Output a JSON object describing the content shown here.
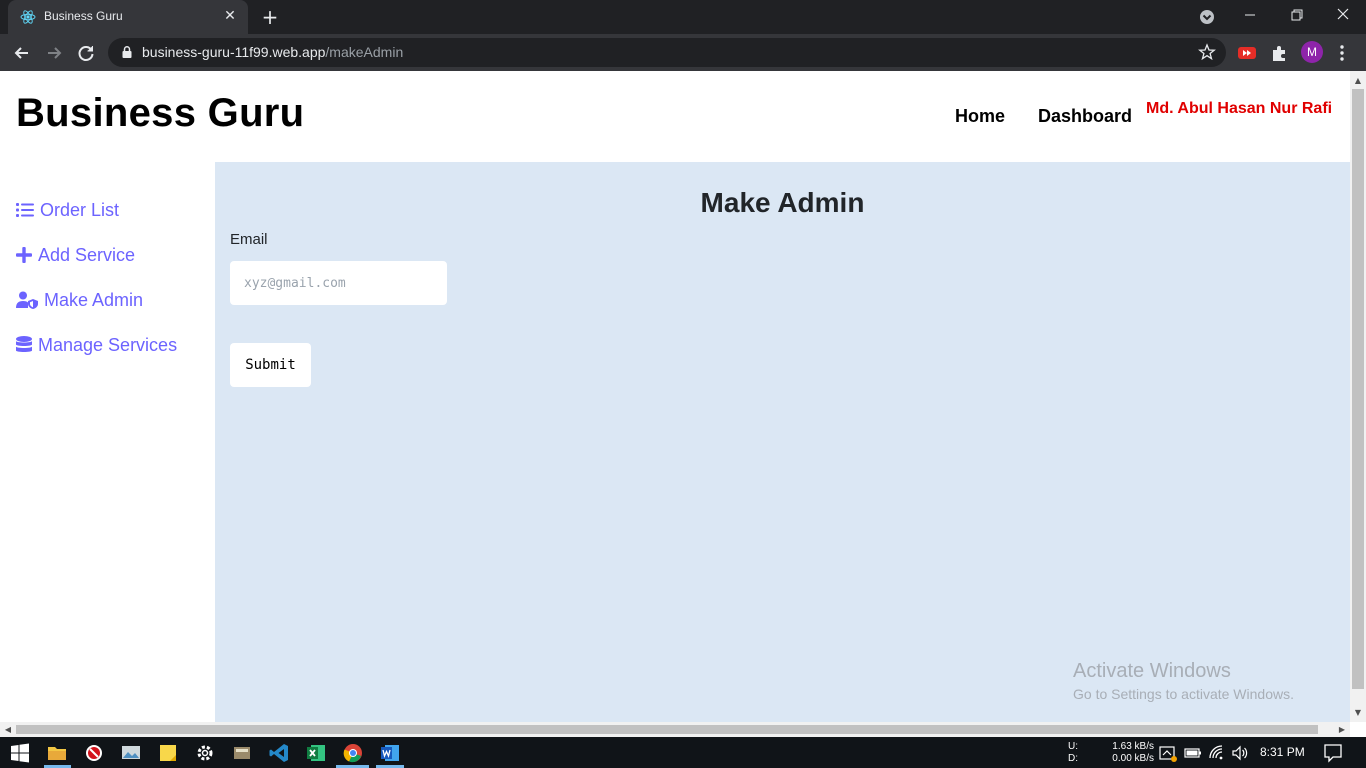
{
  "browser": {
    "tab_title": "Business Guru",
    "tab_close": "✕",
    "new_tab": "+",
    "url_host": "business-guru-11f99.web.app",
    "url_path": "/makeAdmin",
    "profile_initial": "M"
  },
  "header": {
    "brand": "Business Guru",
    "nav": {
      "home": "Home",
      "dashboard": "Dashboard",
      "user": "Md. Abul Hasan Nur Rafi"
    }
  },
  "sidebar": {
    "items": [
      {
        "label": "Order List",
        "icon": "list-icon"
      },
      {
        "label": "Add Service",
        "icon": "plus-icon"
      },
      {
        "label": "Make Admin",
        "icon": "user-shield-icon"
      },
      {
        "label": "Manage Services",
        "icon": "database-icon"
      }
    ]
  },
  "main": {
    "title": "Make Admin",
    "email_label": "Email",
    "email_placeholder": "xyz@gmail.com",
    "email_value": "",
    "submit_label": "Submit"
  },
  "watermark": {
    "line1": "Activate Windows",
    "line2": "Go to Settings to activate Windows."
  },
  "taskbar": {
    "upload_label": "U:",
    "download_label": "D:",
    "upload_speed": "1.63 kB/s",
    "download_speed": "0.00 kB/s",
    "time": "8:31 PM"
  },
  "colors": {
    "accent": "#6c63ff",
    "user_name": "#e00000",
    "main_bg": "#dbe7f4"
  }
}
